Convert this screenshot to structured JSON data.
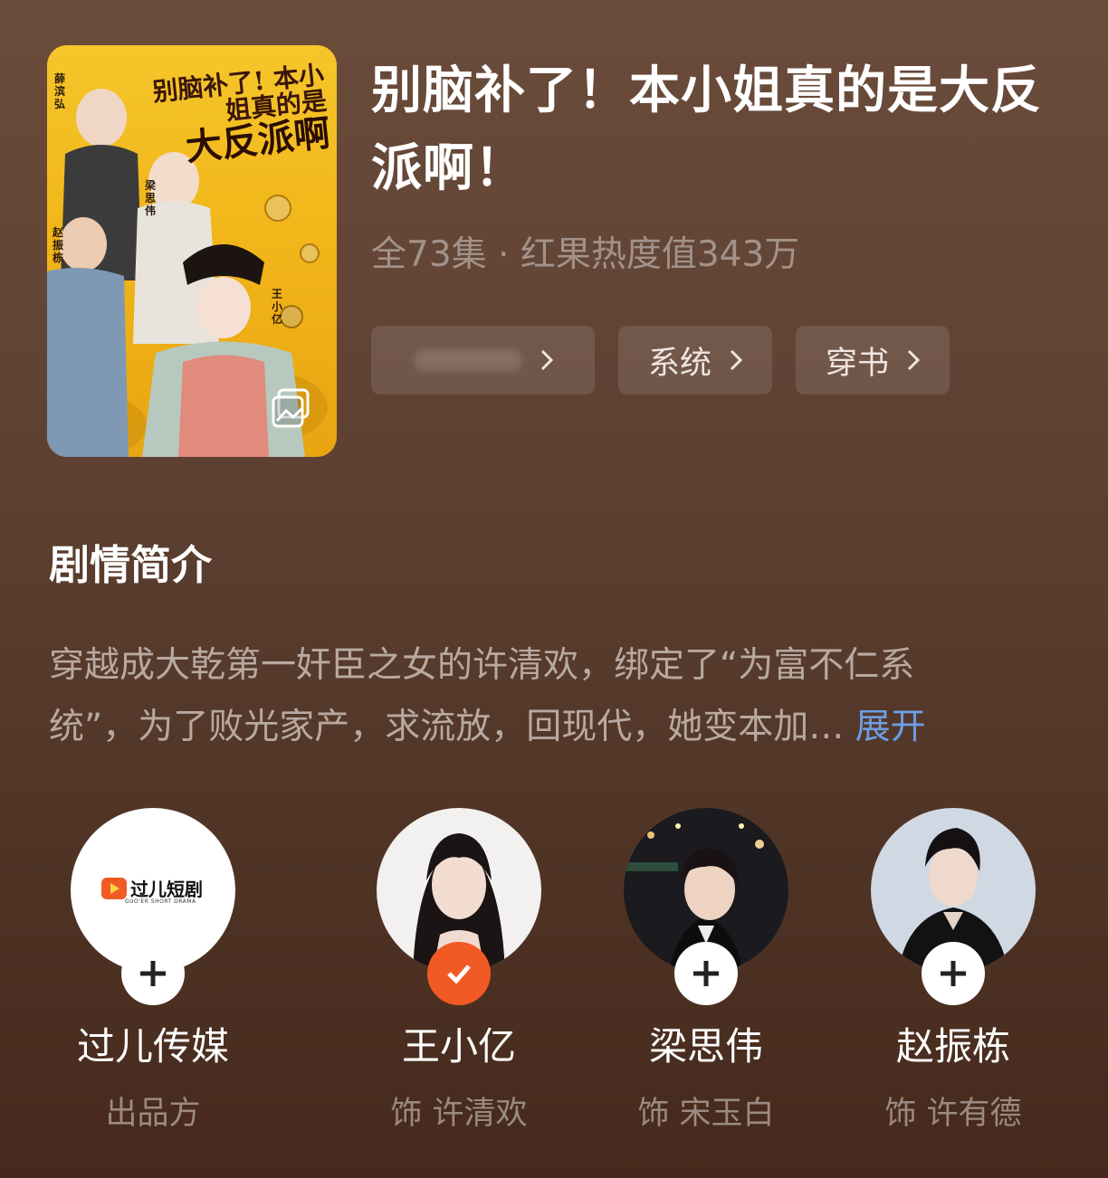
{
  "show": {
    "poster_title_line1": "别脑补了! 本小姐真的是",
    "poster_title_line2": "大反派啊",
    "poster_names": [
      "薛滨弘",
      "梁思伟",
      "赵振栋",
      "王小亿"
    ],
    "title": "别脑补了！本小姐真的是大反派啊！",
    "meta": "全73集 · 红果热度值343万",
    "tags": [
      {
        "label": ""
      },
      {
        "label": "系统"
      },
      {
        "label": "穿书"
      }
    ]
  },
  "synopsis": {
    "heading": "剧情简介",
    "line1": "穿越成大乾第一奸臣之女的许清欢，绑定了“为富不仁系",
    "line2": "统”，为了败光家产，求流放，回现代，她变本加…",
    "expand_label": "展开"
  },
  "cast": [
    {
      "name": "过儿传媒",
      "role": "出品方",
      "followed": false,
      "logo_text": "过儿短剧",
      "logo_sub": "GUO'ER SHORT DRAMA"
    },
    {
      "name": "王小亿",
      "role": "饰 许清欢",
      "followed": true
    },
    {
      "name": "梁思伟",
      "role": "饰 宋玉白",
      "followed": false
    },
    {
      "name": "赵振栋",
      "role": "饰 许有德",
      "followed": false
    }
  ],
  "colors": {
    "accent_follow": "#f15a24",
    "expand_link": "#6c9de4"
  }
}
